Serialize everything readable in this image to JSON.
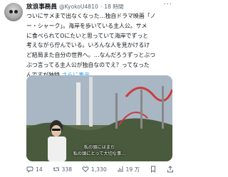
{
  "tweet": {
    "display_name": "放浪事務員",
    "handle": "@KyokoU4810",
    "separator": "·",
    "time": "18 時間",
    "more_label": "···",
    "text": "ついにサメまで出なくなった…独自ドラマ映画「ノ\nー・シャーク」。海岸を歩いている主人公。サメ\nに食べられてOにたいと思っていて海岸でずっと\n考えながら佇んでいる。いろんな人を見かけるけ\nど結局また自分の世界へ。…なんだろうずっとぶつ\nぶつ言ってる主人公が独自なのでえ？ってなった\nんですが独特 ",
    "show_more": "さらに表示",
    "video_caption": "私の頭にはまだ\n私の頭にとって大切な事…"
  },
  "actions": {
    "reply_count": "14",
    "retweet_count": "338",
    "like_count": "1,330",
    "view_count": "19 万"
  },
  "icons": [
    "avatar-icon",
    "more-icon",
    "reply-icon",
    "retweet-icon",
    "like-icon",
    "views-icon",
    "bookmark-icon",
    "share-icon"
  ],
  "colors": {
    "link": "#1d9bf0",
    "muted": "#536471",
    "text": "#0f1419"
  }
}
